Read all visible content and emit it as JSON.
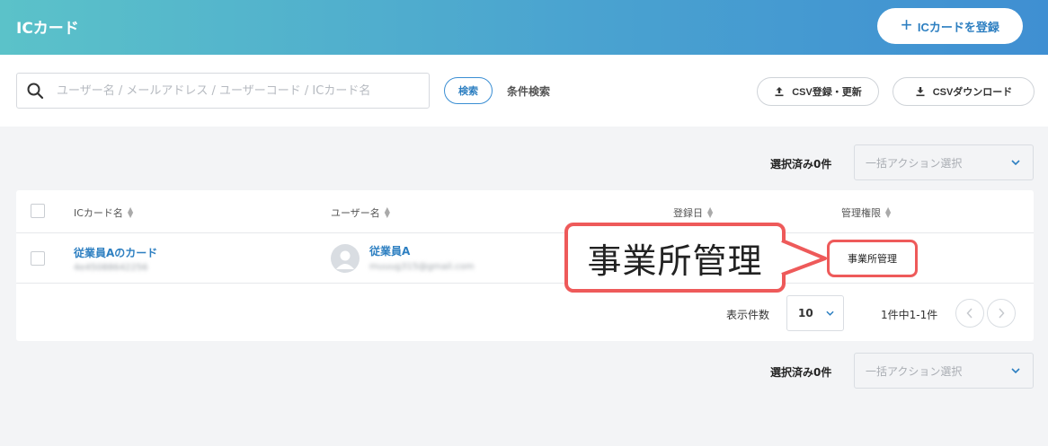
{
  "header": {
    "title": "ICカード",
    "register_label": "ICカードを登録"
  },
  "toolbar": {
    "search_placeholder": "ユーザー名 / メールアドレス / ユーザーコード / ICカード名",
    "search_button": "検索",
    "condition_search": "条件検索",
    "csv_upload": "CSV登録・更新",
    "csv_download": "CSVダウンロード"
  },
  "bulk": {
    "selected_label": "選択済み0件",
    "action_placeholder": "一括アクション選択"
  },
  "table": {
    "columns": [
      "ICカード名",
      "ユーザー名",
      "登録日",
      "管理権限"
    ],
    "rows": [
      {
        "card_name": "従業員Aのカード",
        "card_id": "4e45088642256",
        "user_name": "従業員A",
        "user_email": "muuug315@gmail.com",
        "permission": "事業所管理"
      }
    ]
  },
  "pagination": {
    "per_page_label": "表示件数",
    "per_page_value": "10",
    "count_text": "1件中1-1件"
  },
  "callout": {
    "text": "事業所管理"
  },
  "colors": {
    "accent": "#2d7fc1",
    "highlight": "#ee5a5a"
  }
}
